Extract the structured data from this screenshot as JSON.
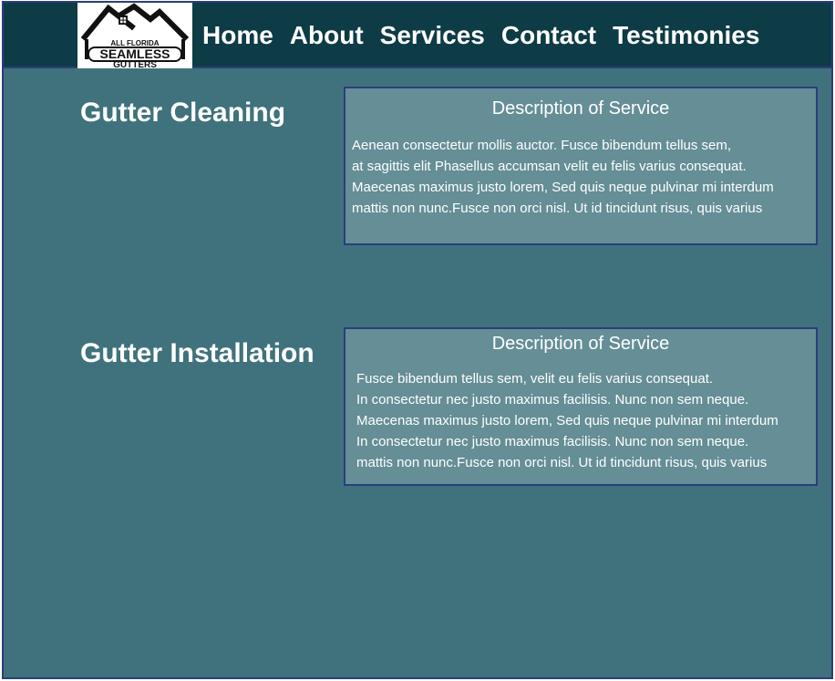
{
  "logo": {
    "line1": "ALL FLORIDA",
    "line2": "SEAMLESS",
    "line3": "GUTTERS"
  },
  "nav": {
    "items": [
      "Home",
      "About",
      "Services",
      "Contact",
      "Testimonies"
    ]
  },
  "services": [
    {
      "title": "Gutter Cleaning",
      "box_heading": "Description of Service",
      "lines": [
        "Aenean consectetur mollis auctor. Fusce bibendum tellus sem,",
        "at sagittis elit Phasellus accumsan velit eu felis varius consequat.",
        "Maecenas maximus justo lorem, Sed quis neque pulvinar mi interdum",
        "mattis non nunc.Fusce non orci nisl. Ut id tincidunt risus, quis varius"
      ]
    },
    {
      "title": "Gutter Installation",
      "box_heading": "Description of Service",
      "lines": [
        "Fusce bibendum tellus sem, velit eu felis varius consequat.",
        "In consectetur nec justo maximus facilisis. Nunc non sem neque.",
        "Maecenas maximus justo lorem, Sed quis neque pulvinar mi interdum",
        "In consectetur nec justo maximus facilisis. Nunc non sem neque.",
        "mattis non nunc.Fusce non orci nisl. Ut id tincidunt risus, quis varius"
      ]
    }
  ]
}
